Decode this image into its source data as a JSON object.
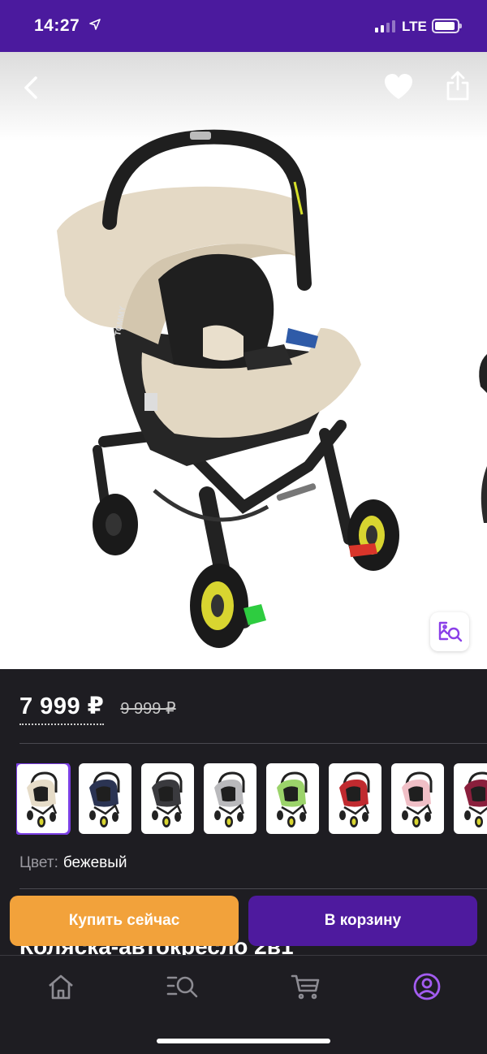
{
  "status_bar": {
    "time": "14:27",
    "network": "LTE",
    "location_icon": "location-arrow-icon",
    "signal_icon": "signal-bars-icon",
    "battery_icon": "battery-icon"
  },
  "gallery": {
    "back_icon": "chevron-left-icon",
    "favorite_icon": "heart-icon",
    "share_icon": "share-icon",
    "visual_search_icon": "image-search-icon",
    "brand_mark": "TOMMY"
  },
  "product": {
    "price_current": "7 999 ₽",
    "price_old": "9 999 ₽",
    "title_peek": "Коляска-автокресло 2в1",
    "color_label": "Цвет:",
    "color_value": "бежевый"
  },
  "swatches": [
    {
      "color": "#e6dcc8",
      "selected": true
    },
    {
      "color": "#2b3453"
    },
    {
      "color": "#3a3a3e"
    },
    {
      "color": "#b9b9bc"
    },
    {
      "color": "#9bd36a"
    },
    {
      "color": "#c02a2f"
    },
    {
      "color": "#f0bfc6"
    },
    {
      "color": "#8a1f3c"
    }
  ],
  "actions": {
    "buy_now": "Купить сейчас",
    "add_to_cart": "В корзину"
  },
  "tab_bar": {
    "items": [
      {
        "icon": "home-icon"
      },
      {
        "icon": "catalog-search-icon"
      },
      {
        "icon": "cart-icon"
      },
      {
        "icon": "profile-icon",
        "active": true
      }
    ]
  },
  "colors": {
    "brand_purple": "#4b1a9e",
    "accent_purple": "#7b3fe4",
    "buy_orange": "#f2a23b",
    "background": "#1e1d22"
  }
}
